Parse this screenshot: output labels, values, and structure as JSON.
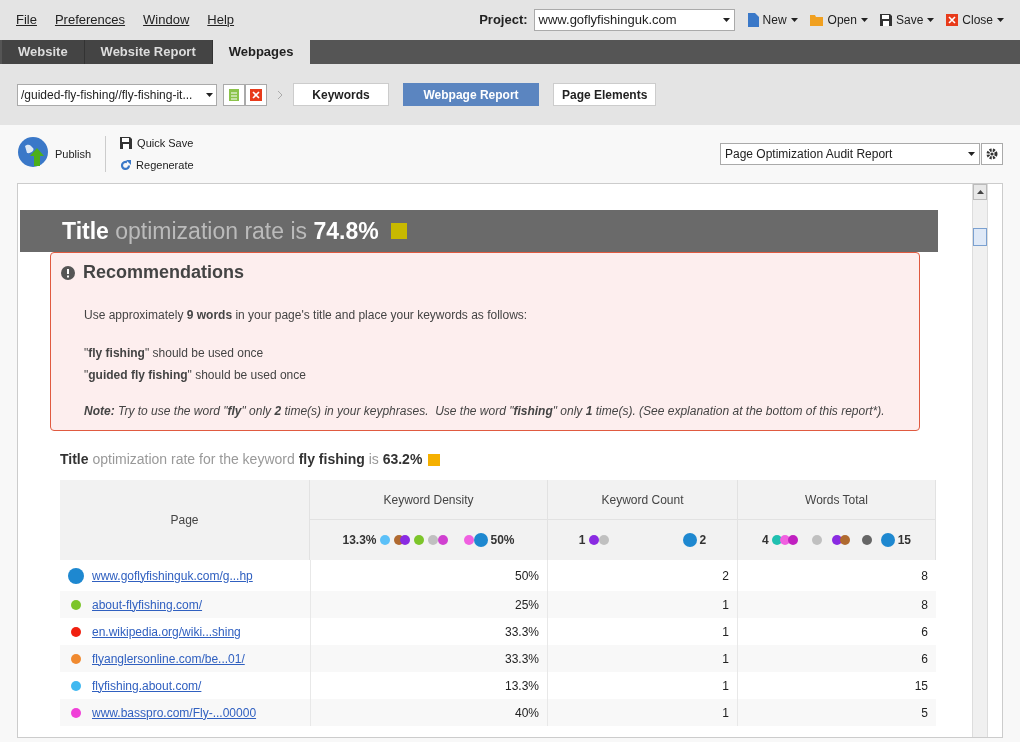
{
  "menu": [
    "File",
    "Preferences",
    "Window",
    "Help"
  ],
  "project": {
    "label": "Project:",
    "value": "www.goflyfishinguk.com"
  },
  "actions": [
    {
      "label": "New",
      "kind": "new"
    },
    {
      "label": "Open",
      "kind": "open"
    },
    {
      "label": "Save",
      "kind": "save"
    },
    {
      "label": "Close",
      "kind": "close"
    }
  ],
  "tabs": [
    {
      "label": "Website",
      "selected": false
    },
    {
      "label": "Website Report",
      "selected": false
    },
    {
      "label": "Webpages",
      "selected": true
    }
  ],
  "page_select": "/guided-fly-fishing//fly-fishing-it...",
  "views": [
    {
      "label": "Keywords",
      "selected": false
    },
    {
      "label": "Webpage Report",
      "selected": true
    },
    {
      "label": "Page Elements",
      "selected": false
    }
  ],
  "toolbar": {
    "publish": "Publish",
    "quick_save": "Quick Save",
    "regenerate": "Regenerate",
    "report_select": "Page Optimization Audit Report"
  },
  "report": {
    "title": "**Title** optimization rate is **74.8%**",
    "rate_indicators": [
      {
        "color": "#c8b900"
      },
      {
        "color": "#f5b000"
      }
    ],
    "recommendations": {
      "heading": "Recommendations",
      "intro": "Use approximately **9 words** in your page's title and place your keywords as follows:",
      "items": [
        "\"**fly fishing**\" should be used once",
        "\"**guided fly fishing**\" should be used once"
      ],
      "note": "**Note:** Try to use the word \"**fly**\" only **2** time(s) in your keyphrases.  Use the word \"**fishing**\" only **1** time(s). (See explanation at the bottom of this report*)."
    },
    "keyword_line": "**Title** optimization rate for the keyword **fly fishing** is **63.2%**",
    "columns": [
      "Page",
      "Keyword Density",
      "Keyword Count",
      "Words Total"
    ],
    "scales": [
      {
        "min": "13.3%",
        "max": "50%"
      },
      {
        "min": "1",
        "max": "2"
      },
      {
        "min": "4",
        "max": "15"
      }
    ],
    "rows": [
      {
        "page": "www.goflyfishinguk.com/g...hp",
        "density": "50%",
        "count": "2",
        "total": "8",
        "color": "#1e88d0",
        "kind": "own"
      },
      {
        "page": "about-flyfishing.com/",
        "density": "25%",
        "count": "1",
        "total": "8",
        "color": "#7cc52a",
        "kind": "competitor"
      },
      {
        "page": "en.wikipedia.org/wiki...shing",
        "density": "33.3%",
        "count": "1",
        "total": "6",
        "color": "#f02010",
        "kind": "competitor"
      },
      {
        "page": "flyanglersonline.com/be...01/",
        "density": "33.3%",
        "count": "1",
        "total": "6",
        "color": "#f08a30",
        "kind": "competitor"
      },
      {
        "page": "flyfishing.about.com/",
        "density": "13.3%",
        "count": "1",
        "total": "15",
        "color": "#40b8f0",
        "kind": "competitor"
      },
      {
        "page": "www.basspro.com/Fly-...00000",
        "density": "40%",
        "count": "1",
        "total": "5",
        "color": "#f040d8",
        "kind": "competitor"
      }
    ]
  }
}
